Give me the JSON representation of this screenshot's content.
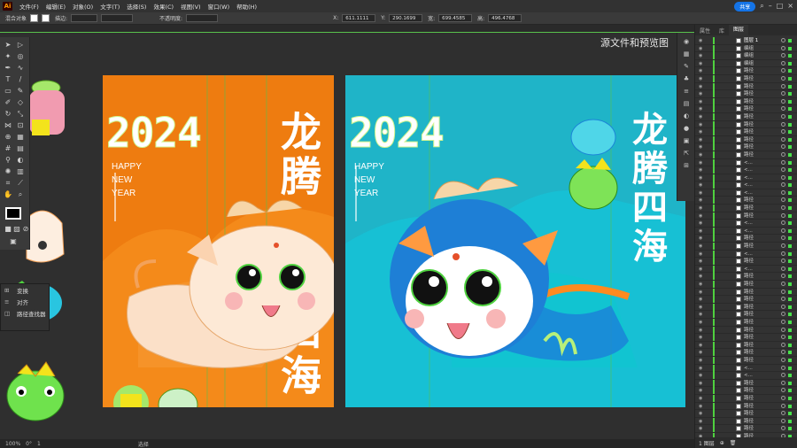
{
  "menubar": {
    "logo": "Ai",
    "items": [
      "文件(F)",
      "编辑(E)",
      "对象(O)",
      "文字(T)",
      "选择(S)",
      "效果(C)",
      "视图(V)",
      "窗口(W)",
      "帮助(H)"
    ],
    "share": "共享"
  },
  "controlbar": {
    "selection": "混合对象",
    "stroke_label": "描边:",
    "opacity_label": "不透明度:",
    "x_label": "X:",
    "x_value": "611.1111",
    "y_label": "Y:",
    "y_value": "290.1699",
    "w_label": "宽:",
    "w_value": "699.4585",
    "h_label": "高:",
    "h_value": "496.4768"
  },
  "canvas": {
    "title": "源文件和预览图"
  },
  "artboards": {
    "left": {
      "year": "2024",
      "greeting": [
        "HAPPY",
        "NEW",
        "YEAR"
      ],
      "title_top": "龙腾",
      "title_bottom": "四海"
    },
    "right": {
      "year": "2024",
      "greeting": [
        "HAPPY",
        "NEW",
        "YEAR"
      ],
      "title": "龙腾四海"
    }
  },
  "float_panel": {
    "items": [
      {
        "icon": "transform-icon",
        "label": "变换"
      },
      {
        "icon": "align-icon",
        "label": "对齐"
      },
      {
        "icon": "pathfinder-icon",
        "label": "路径查找器"
      }
    ]
  },
  "layers_panel": {
    "tabs": [
      "属性",
      "库",
      "图层"
    ],
    "active_tab": "图层",
    "layer_name": "图层 1",
    "rows": [
      "图层 1",
      "编组",
      "编组",
      "编组",
      "路径",
      "路径",
      "路径",
      "路径",
      "路径",
      "路径",
      "路径",
      "路径",
      "路径",
      "路径",
      "路径",
      "路径",
      "<...",
      "<...",
      "<...",
      "<...",
      "<...",
      "路径",
      "路径",
      "路径",
      "<...",
      "<...",
      "路径",
      "路径",
      "<...",
      "路径",
      "<...",
      "路径",
      "路径",
      "路径",
      "路径",
      "路径",
      "路径",
      "路径",
      "路径",
      "路径",
      "路径",
      "路径",
      "路径",
      "<...",
      "<...",
      "路径",
      "路径",
      "路径",
      "路径",
      "路径",
      "路径",
      "路径",
      "路径",
      "路径"
    ],
    "footer": "1 图层"
  },
  "statusbar": {
    "zoom": "100%",
    "rotate": "0°",
    "artboard": "1",
    "tool": "选择"
  },
  "colors": {
    "orange": "#ee7c10",
    "teal": "#1fb4c8",
    "guide_green": "#58c24c",
    "accent_blue": "#1473e6"
  }
}
